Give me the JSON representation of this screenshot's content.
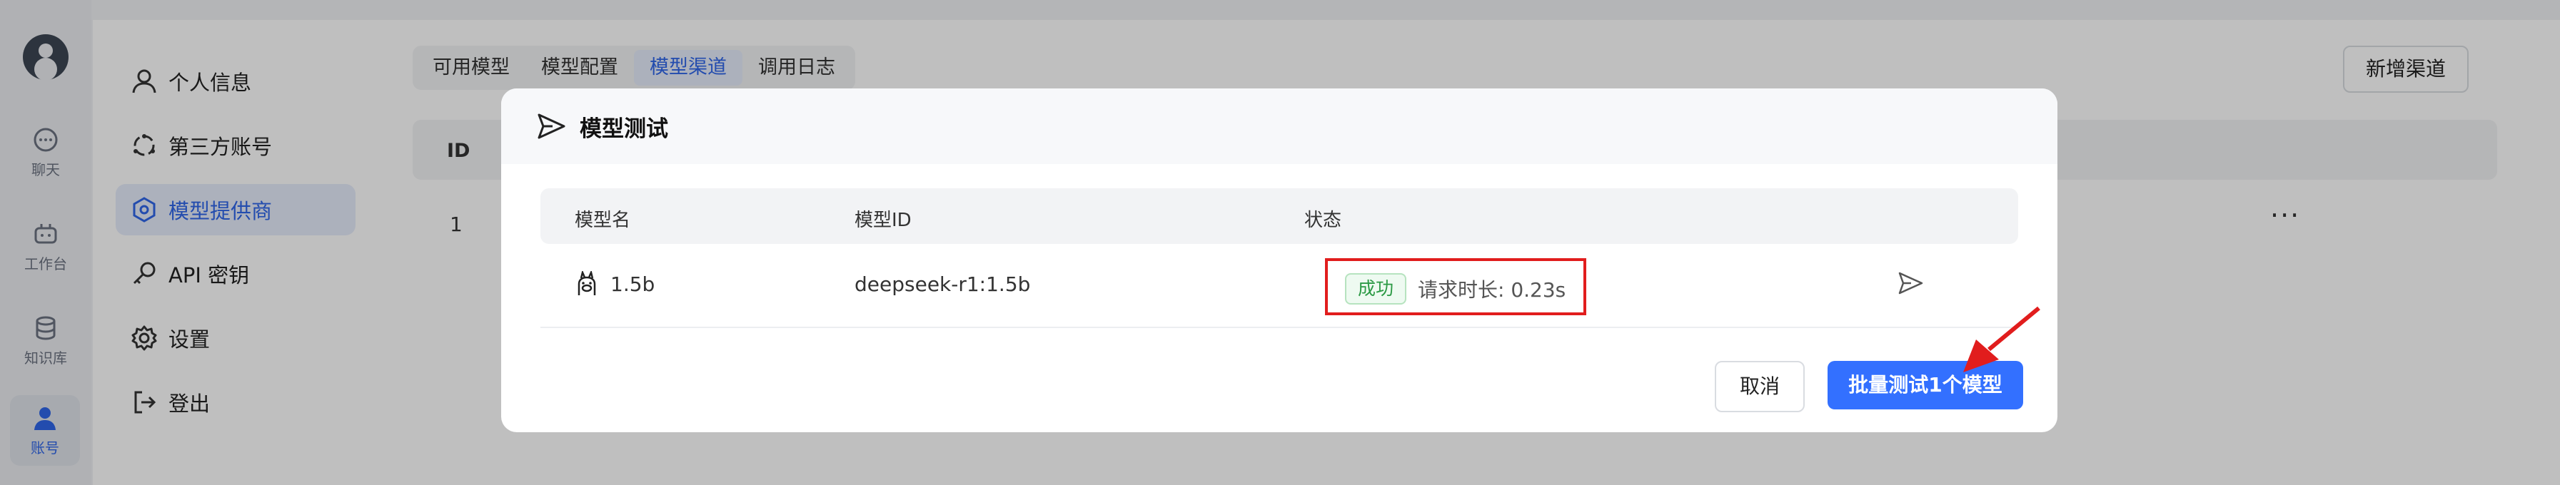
{
  "rail": {
    "items": [
      {
        "label": "聊天",
        "icon": "chat-icon"
      },
      {
        "label": "工作台",
        "icon": "workbench-icon"
      },
      {
        "label": "知识库",
        "icon": "database-icon"
      },
      {
        "label": "账号",
        "icon": "user-icon"
      }
    ]
  },
  "account_menu": {
    "items": [
      {
        "label": "个人信息",
        "icon": "user-icon"
      },
      {
        "label": "第三方账号",
        "icon": "link-icon"
      },
      {
        "label": "模型提供商",
        "icon": "model-provider-icon"
      },
      {
        "label": "API 密钥",
        "icon": "key-icon"
      },
      {
        "label": "设置",
        "icon": "gear-icon"
      },
      {
        "label": "登出",
        "icon": "logout-icon"
      }
    ]
  },
  "main": {
    "tabs": [
      {
        "label": "可用模型"
      },
      {
        "label": "模型配置"
      },
      {
        "label": "模型渠道"
      },
      {
        "label": "调用日志"
      }
    ],
    "add_label": "新增渠道",
    "table": {
      "id_header": "ID",
      "first_row_id": "1",
      "more_label": "···"
    }
  },
  "modal": {
    "title": "模型测试",
    "columns": [
      "模型名",
      "模型ID",
      "状态"
    ],
    "rows": [
      {
        "name": "1.5b",
        "model_id": "deepseek-r1:1.5b",
        "status": "成功",
        "duration": "请求时长: 0.23s"
      }
    ],
    "cancel_label": "取消",
    "batch_label": "批量测试1个模型"
  },
  "colors": {
    "accent": "#3370ff",
    "success": "#2c9a45",
    "highlight": "#e11d1d"
  }
}
